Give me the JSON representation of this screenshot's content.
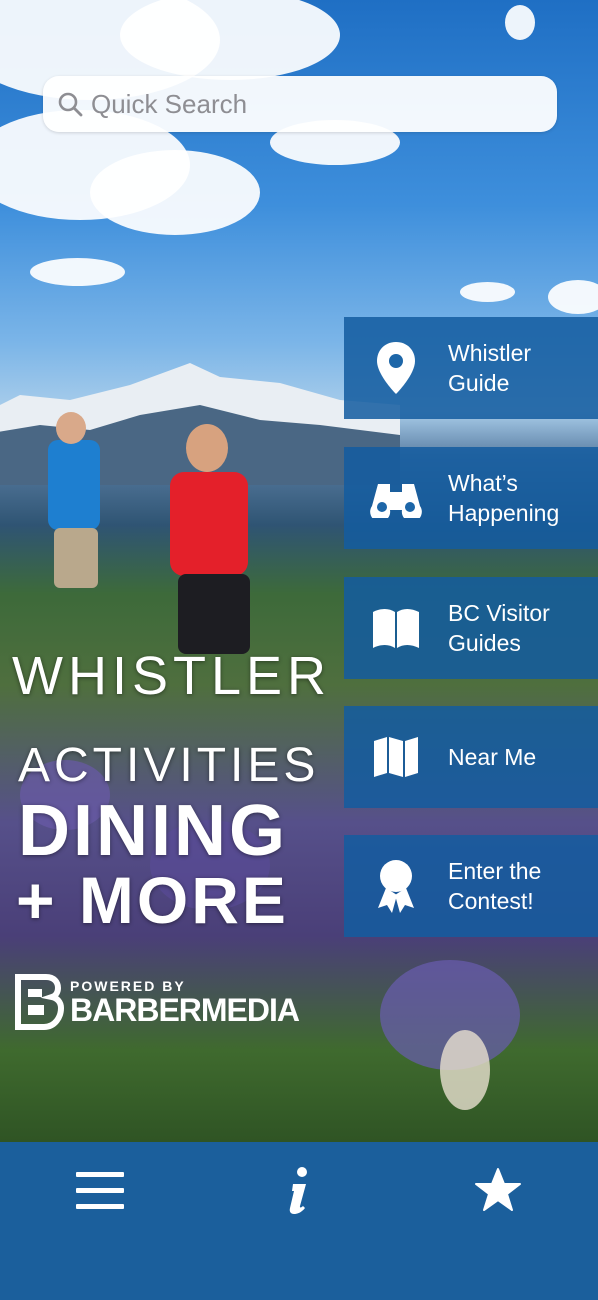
{
  "search": {
    "placeholder": "Quick Search",
    "icon": "search-icon"
  },
  "menu": [
    {
      "label": "Whistler\nGuide",
      "icon": "map-pin-icon"
    },
    {
      "label": "What’s\nHappening",
      "icon": "binoculars-icon"
    },
    {
      "label": "BC Visitor\nGuides",
      "icon": "book-icon"
    },
    {
      "label": "Near Me",
      "icon": "map-icon"
    },
    {
      "label": "Enter the\nContest!",
      "icon": "award-ribbon-icon"
    }
  ],
  "hero": {
    "title": "WHISTLER",
    "line1": "ACTIVITIES",
    "line2": "DINING",
    "line3": "+ MORE"
  },
  "logo": {
    "powered_by": "POWERED BY",
    "name": "BARBERMEDIA"
  },
  "tabbar": [
    {
      "icon": "menu-icon"
    },
    {
      "icon": "info-icon"
    },
    {
      "icon": "star-icon"
    }
  ],
  "colors": {
    "menu_blue": "#145ca0",
    "tabbar_blue": "#1b5f9c"
  }
}
